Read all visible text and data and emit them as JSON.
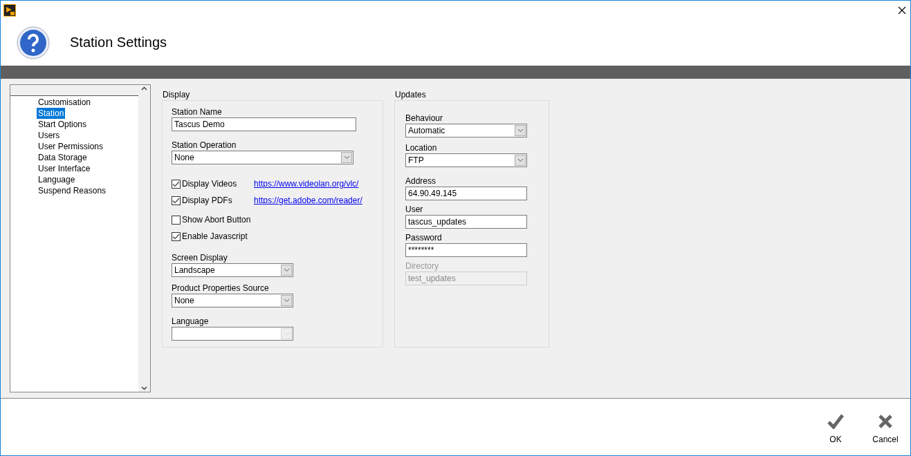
{
  "window": {
    "title": "Station Settings"
  },
  "sidebar": {
    "items": [
      {
        "label": "Customisation",
        "selected": false
      },
      {
        "label": "Station",
        "selected": true
      },
      {
        "label": "Start Options",
        "selected": false
      },
      {
        "label": "Users",
        "selected": false
      },
      {
        "label": "User Permissions",
        "selected": false
      },
      {
        "label": "Data Storage",
        "selected": false
      },
      {
        "label": "User Interface",
        "selected": false
      },
      {
        "label": "Language",
        "selected": false
      },
      {
        "label": "Suspend Reasons",
        "selected": false
      }
    ]
  },
  "display": {
    "title": "Display",
    "items": [
      {
        "kind": "text",
        "label": "Station Name",
        "value": "Tascus Demo",
        "disabled": false
      },
      {
        "kind": "select",
        "label": "Station Operation",
        "value": "None",
        "disabled": false
      },
      {
        "kind": "checkbox",
        "label": "Display Videos",
        "checked": true,
        "link": "https://www.videolan.org/vlc/"
      },
      {
        "kind": "checkbox",
        "label": "Display PDFs",
        "checked": true,
        "link": "https://get.adobe.com/reader/"
      },
      {
        "kind": "checkbox",
        "label": "Show Abort Button",
        "checked": false
      },
      {
        "kind": "checkbox",
        "label": "Enable Javascript",
        "checked": true
      },
      {
        "kind": "select",
        "label": "Screen Display",
        "value": "Landscape",
        "disabled": false
      },
      {
        "kind": "select",
        "label": "Product Properties Source",
        "value": "None",
        "disabled": false
      },
      {
        "kind": "select",
        "label": "Language",
        "disabled": true
      }
    ]
  },
  "updates": {
    "title": "Updates",
    "items": [
      {
        "kind": "select",
        "label": "Behaviour",
        "value": "Automatic",
        "disabled": false
      },
      {
        "kind": "select",
        "label": "Location",
        "value": "FTP",
        "disabled": false
      },
      {
        "kind": "text",
        "label": "Address",
        "value": "64.90.49.145",
        "disabled": false
      },
      {
        "kind": "text",
        "label": "User",
        "value": "tascus_updates",
        "disabled": false
      },
      {
        "kind": "text",
        "label": "Password",
        "value": "********",
        "disabled": false
      },
      {
        "kind": "text",
        "label": "Directory",
        "value": "test_updates",
        "disabled": true
      }
    ]
  },
  "buttons": [
    {
      "kind": "ok",
      "label": "OK"
    },
    {
      "kind": "cancel",
      "label": "Cancel"
    }
  ]
}
